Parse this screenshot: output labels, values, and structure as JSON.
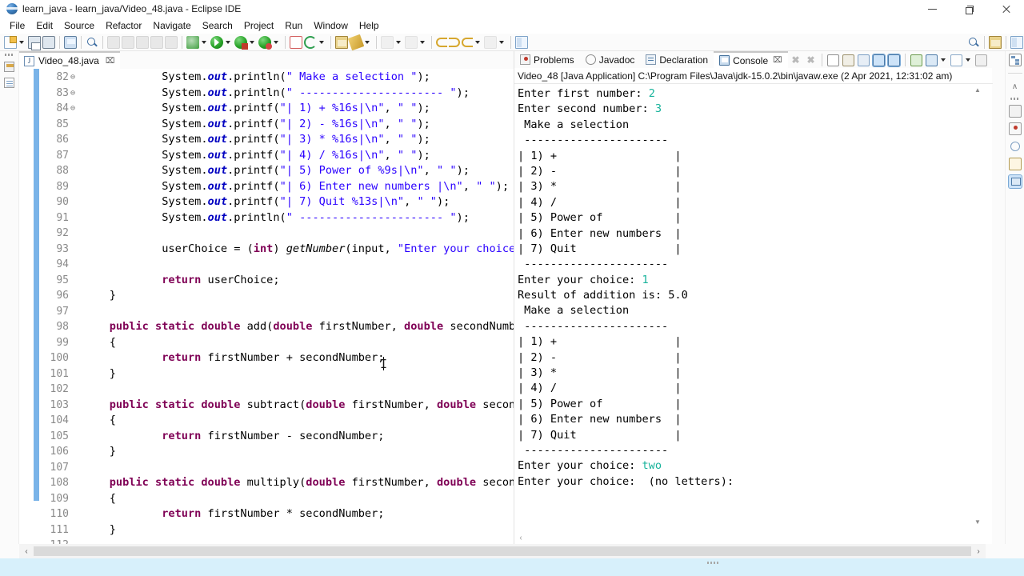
{
  "window": {
    "title": "learn_java - learn_java/Video_48.java - Eclipse IDE",
    "minimize_label": "—",
    "maximize_label": "❐",
    "close_label": "✕"
  },
  "menubar": {
    "items": [
      "File",
      "Edit",
      "Source",
      "Refactor",
      "Navigate",
      "Search",
      "Project",
      "Run",
      "Window",
      "Help"
    ]
  },
  "toolbar": {
    "icons": [
      "new-file-icon",
      "save-icon",
      "save-all-icon",
      "print-icon",
      "search-icon",
      "quick-access-icon",
      "build-icon",
      "external-tools-icon",
      "debug-icon",
      "run-icon",
      "run-as-icon",
      "coverage-icon",
      "new-java-project-icon",
      "new-class-icon",
      "open-type-icon",
      "back-icon",
      "forward-icon",
      "previous-annotation-icon",
      "next-annotation-icon",
      "perspective-icon"
    ]
  },
  "editor": {
    "tab": {
      "label": "Video_48.java",
      "icon": "java-file-icon",
      "close_label": "⌧"
    },
    "first_line_number": 82,
    "lines": [
      {
        "n": 82,
        "fold": "",
        "indent": 3,
        "tokens": [
          {
            "t": "System.",
            "c": "plain"
          },
          {
            "t": "out",
            "c": "bital"
          },
          {
            "t": ".println(",
            "c": "plain"
          },
          {
            "t": "\" Make a selection \"",
            "c": "str"
          },
          {
            "t": ");",
            "c": "plain"
          }
        ]
      },
      {
        "n": 83,
        "fold": "",
        "indent": 3,
        "tokens": [
          {
            "t": "System.",
            "c": "plain"
          },
          {
            "t": "out",
            "c": "bital"
          },
          {
            "t": ".println(",
            "c": "plain"
          },
          {
            "t": "\" ---------------------- \"",
            "c": "str"
          },
          {
            "t": ");",
            "c": "plain"
          }
        ]
      },
      {
        "n": 84,
        "fold": "",
        "indent": 3,
        "tokens": [
          {
            "t": "System.",
            "c": "plain"
          },
          {
            "t": "out",
            "c": "bital"
          },
          {
            "t": ".printf(",
            "c": "plain"
          },
          {
            "t": "\"| 1) + %16s|\\n\"",
            "c": "str"
          },
          {
            "t": ", ",
            "c": "plain"
          },
          {
            "t": "\" \"",
            "c": "str"
          },
          {
            "t": ");",
            "c": "plain"
          }
        ]
      },
      {
        "n": 85,
        "fold": "",
        "indent": 3,
        "tokens": [
          {
            "t": "System.",
            "c": "plain"
          },
          {
            "t": "out",
            "c": "bital"
          },
          {
            "t": ".printf(",
            "c": "plain"
          },
          {
            "t": "\"| 2) - %16s|\\n\"",
            "c": "str"
          },
          {
            "t": ", ",
            "c": "plain"
          },
          {
            "t": "\" \"",
            "c": "str"
          },
          {
            "t": ");",
            "c": "plain"
          }
        ]
      },
      {
        "n": 86,
        "fold": "",
        "indent": 3,
        "tokens": [
          {
            "t": "System.",
            "c": "plain"
          },
          {
            "t": "out",
            "c": "bital"
          },
          {
            "t": ".printf(",
            "c": "plain"
          },
          {
            "t": "\"| 3) * %16s|\\n\"",
            "c": "str"
          },
          {
            "t": ", ",
            "c": "plain"
          },
          {
            "t": "\" \"",
            "c": "str"
          },
          {
            "t": ");",
            "c": "plain"
          }
        ]
      },
      {
        "n": 87,
        "fold": "",
        "indent": 3,
        "tokens": [
          {
            "t": "System.",
            "c": "plain"
          },
          {
            "t": "out",
            "c": "bital"
          },
          {
            "t": ".printf(",
            "c": "plain"
          },
          {
            "t": "\"| 4) / %16s|\\n\"",
            "c": "str"
          },
          {
            "t": ", ",
            "c": "plain"
          },
          {
            "t": "\" \"",
            "c": "str"
          },
          {
            "t": ");",
            "c": "plain"
          }
        ]
      },
      {
        "n": 88,
        "fold": "",
        "indent": 3,
        "tokens": [
          {
            "t": "System.",
            "c": "plain"
          },
          {
            "t": "out",
            "c": "bital"
          },
          {
            "t": ".printf(",
            "c": "plain"
          },
          {
            "t": "\"| 5) Power of %9s|\\n\"",
            "c": "str"
          },
          {
            "t": ", ",
            "c": "plain"
          },
          {
            "t": "\" \"",
            "c": "str"
          },
          {
            "t": ");",
            "c": "plain"
          }
        ]
      },
      {
        "n": 89,
        "fold": "",
        "indent": 3,
        "tokens": [
          {
            "t": "System.",
            "c": "plain"
          },
          {
            "t": "out",
            "c": "bital"
          },
          {
            "t": ".printf(",
            "c": "plain"
          },
          {
            "t": "\"| 6) Enter new numbers |\\n\"",
            "c": "str"
          },
          {
            "t": ", ",
            "c": "plain"
          },
          {
            "t": "\" \"",
            "c": "str"
          },
          {
            "t": ");",
            "c": "plain"
          }
        ]
      },
      {
        "n": 90,
        "fold": "",
        "indent": 3,
        "tokens": [
          {
            "t": "System.",
            "c": "plain"
          },
          {
            "t": "out",
            "c": "bital"
          },
          {
            "t": ".printf(",
            "c": "plain"
          },
          {
            "t": "\"| 7) Quit %13s|\\n\"",
            "c": "str"
          },
          {
            "t": ", ",
            "c": "plain"
          },
          {
            "t": "\" \"",
            "c": "str"
          },
          {
            "t": ");",
            "c": "plain"
          }
        ]
      },
      {
        "n": 91,
        "fold": "",
        "indent": 3,
        "tokens": [
          {
            "t": "System.",
            "c": "plain"
          },
          {
            "t": "out",
            "c": "bital"
          },
          {
            "t": ".println(",
            "c": "plain"
          },
          {
            "t": "\" ---------------------- \"",
            "c": "str"
          },
          {
            "t": ");",
            "c": "plain"
          }
        ]
      },
      {
        "n": 92,
        "fold": "",
        "indent": 0,
        "tokens": []
      },
      {
        "n": 93,
        "fold": "",
        "indent": 3,
        "tokens": [
          {
            "t": "userChoice = (",
            "c": "plain"
          },
          {
            "t": "int",
            "c": "kw"
          },
          {
            "t": ") ",
            "c": "plain"
          },
          {
            "t": "getNumber",
            "c": "ital"
          },
          {
            "t": "(input, ",
            "c": "plain"
          },
          {
            "t": "\"Enter your choice: \"",
            "c": "str"
          },
          {
            "t": ")",
            "c": "plain"
          }
        ]
      },
      {
        "n": 94,
        "fold": "",
        "indent": 0,
        "tokens": []
      },
      {
        "n": 95,
        "fold": "",
        "indent": 3,
        "tokens": [
          {
            "t": "return",
            "c": "kw"
          },
          {
            "t": " userChoice;",
            "c": "plain"
          }
        ]
      },
      {
        "n": 96,
        "fold": "",
        "indent": 1,
        "tokens": [
          {
            "t": "}",
            "c": "plain"
          }
        ]
      },
      {
        "n": 97,
        "fold": "",
        "indent": 0,
        "tokens": []
      },
      {
        "n": 98,
        "fold": "⊖",
        "indent": 1,
        "tokens": [
          {
            "t": "public static double",
            "c": "kw"
          },
          {
            "t": " add(",
            "c": "plain"
          },
          {
            "t": "double",
            "c": "kw"
          },
          {
            "t": " firstNumber, ",
            "c": "plain"
          },
          {
            "t": "double",
            "c": "kw"
          },
          {
            "t": " secondNumb",
            "c": "plain"
          }
        ]
      },
      {
        "n": 99,
        "fold": "",
        "indent": 1,
        "tokens": [
          {
            "t": "{",
            "c": "plain"
          }
        ]
      },
      {
        "n": 100,
        "fold": "",
        "indent": 3,
        "tokens": [
          {
            "t": "return",
            "c": "kw"
          },
          {
            "t": " firstNumber + secondNumber;",
            "c": "plain"
          }
        ]
      },
      {
        "n": 101,
        "fold": "",
        "indent": 1,
        "tokens": [
          {
            "t": "}",
            "c": "plain"
          }
        ]
      },
      {
        "n": 102,
        "fold": "",
        "indent": 0,
        "tokens": []
      },
      {
        "n": 103,
        "fold": "⊖",
        "indent": 1,
        "tokens": [
          {
            "t": "public static double",
            "c": "kw"
          },
          {
            "t": " subtract(",
            "c": "plain"
          },
          {
            "t": "double",
            "c": "kw"
          },
          {
            "t": " firstNumber, ",
            "c": "plain"
          },
          {
            "t": "double",
            "c": "kw"
          },
          {
            "t": " secon",
            "c": "plain"
          }
        ]
      },
      {
        "n": 104,
        "fold": "",
        "indent": 1,
        "tokens": [
          {
            "t": "{",
            "c": "plain"
          }
        ]
      },
      {
        "n": 105,
        "fold": "",
        "indent": 3,
        "tokens": [
          {
            "t": "return",
            "c": "kw"
          },
          {
            "t": " firstNumber - secondNumber;",
            "c": "plain"
          }
        ]
      },
      {
        "n": 106,
        "fold": "",
        "indent": 1,
        "tokens": [
          {
            "t": "}",
            "c": "plain"
          }
        ]
      },
      {
        "n": 107,
        "fold": "",
        "indent": 0,
        "tokens": []
      },
      {
        "n": 108,
        "fold": "⊖",
        "indent": 1,
        "tokens": [
          {
            "t": "public static double",
            "c": "kw"
          },
          {
            "t": " multiply(",
            "c": "plain"
          },
          {
            "t": "double",
            "c": "kw"
          },
          {
            "t": " firstNumber, ",
            "c": "plain"
          },
          {
            "t": "double",
            "c": "kw"
          },
          {
            "t": " secon",
            "c": "plain"
          }
        ]
      },
      {
        "n": 109,
        "fold": "",
        "indent": 1,
        "tokens": [
          {
            "t": "{",
            "c": "plain"
          }
        ]
      },
      {
        "n": 110,
        "fold": "",
        "indent": 3,
        "tokens": [
          {
            "t": "return",
            "c": "kw"
          },
          {
            "t": " firstNumber * secondNumber;",
            "c": "plain"
          }
        ]
      },
      {
        "n": 111,
        "fold": "",
        "indent": 1,
        "tokens": [
          {
            "t": "}",
            "c": "plain"
          }
        ]
      },
      {
        "n": 112,
        "fold": "",
        "indent": 0,
        "tokens": []
      }
    ],
    "scroll_left_label": "‹",
    "scroll_right_label": "›"
  },
  "console": {
    "tabs": [
      {
        "label": "Problems",
        "icon": "problems-icon",
        "active": false
      },
      {
        "label": "Javadoc",
        "icon": "javadoc-icon",
        "active": false
      },
      {
        "label": "Declaration",
        "icon": "declaration-icon",
        "active": false
      },
      {
        "label": "Console",
        "icon": "console-icon",
        "active": true,
        "close_label": "⌧"
      }
    ],
    "toolbar_icons": [
      "terminate-icon",
      "remove-launch-icon",
      "remove-all-launches-icon",
      "clear-console-icon",
      "scroll-lock-icon",
      "pin-console-icon",
      "display-selected-console-icon",
      "open-console-icon",
      "new-console-view-icon",
      "console-menu-icon",
      "minimize-icon"
    ],
    "header": "Video_48 [Java Application] C:\\Program Files\\Java\\jdk-15.0.2\\bin\\javaw.exe  (2 Apr 2021, 12:31:02 am)",
    "lines": [
      [
        {
          "t": "Enter first number: ",
          "c": "plain"
        },
        {
          "t": "2",
          "c": "inval"
        }
      ],
      [
        {
          "t": "Enter second number: ",
          "c": "plain"
        },
        {
          "t": "3",
          "c": "inval"
        }
      ],
      [
        {
          "t": " Make a selection",
          "c": "plain"
        }
      ],
      [
        {
          "t": " ----------------------",
          "c": "plain"
        }
      ],
      [
        {
          "t": "| 1) +                  |",
          "c": "plain"
        }
      ],
      [
        {
          "t": "| 2) -                  |",
          "c": "plain"
        }
      ],
      [
        {
          "t": "| 3) *                  |",
          "c": "plain"
        }
      ],
      [
        {
          "t": "| 4) /                  |",
          "c": "plain"
        }
      ],
      [
        {
          "t": "| 5) Power of           |",
          "c": "plain"
        }
      ],
      [
        {
          "t": "| 6) Enter new numbers  |",
          "c": "plain"
        }
      ],
      [
        {
          "t": "| 7) Quit               |",
          "c": "plain"
        }
      ],
      [
        {
          "t": " ----------------------",
          "c": "plain"
        }
      ],
      [
        {
          "t": "Enter your choice: ",
          "c": "plain"
        },
        {
          "t": "1",
          "c": "inval"
        }
      ],
      [
        {
          "t": "Result of addition is: 5.0",
          "c": "plain"
        }
      ],
      [
        {
          "t": " Make a selection",
          "c": "plain"
        }
      ],
      [
        {
          "t": " ----------------------",
          "c": "plain"
        }
      ],
      [
        {
          "t": "| 1) +                  |",
          "c": "plain"
        }
      ],
      [
        {
          "t": "| 2) -                  |",
          "c": "plain"
        }
      ],
      [
        {
          "t": "| 3) *                  |",
          "c": "plain"
        }
      ],
      [
        {
          "t": "| 4) /                  |",
          "c": "plain"
        }
      ],
      [
        {
          "t": "| 5) Power of           |",
          "c": "plain"
        }
      ],
      [
        {
          "t": "| 6) Enter new numbers  |",
          "c": "plain"
        }
      ],
      [
        {
          "t": "| 7) Quit               |",
          "c": "plain"
        }
      ],
      [
        {
          "t": " ----------------------",
          "c": "plain"
        }
      ],
      [
        {
          "t": "Enter your choice: ",
          "c": "plain"
        },
        {
          "t": "two",
          "c": "inval"
        }
      ],
      [
        {
          "t": "Enter your choice:  (no letters):",
          "c": "plain"
        }
      ]
    ],
    "scroll_left_label": "‹",
    "scroll_up_label": "▲",
    "scroll_down_label": "▼"
  },
  "left_strip": {
    "icons": [
      "package-explorer-icon",
      "outline-icon"
    ]
  },
  "right_strip": {
    "icons": [
      "hierarchy-icon",
      "restore-icon",
      "problems-view-icon",
      "javadoc-view-icon",
      "declaration-view-icon",
      "console-view-icon"
    ],
    "collapse_label": "∧"
  },
  "colors": {
    "keyword": "#7f0055",
    "string": "#2a00ff",
    "field": "#0000c0",
    "console_input": "#18b39b",
    "change_bar": "#79b3e8",
    "status_bar": "#d7f0fb",
    "tab_active": "#ffffff"
  }
}
